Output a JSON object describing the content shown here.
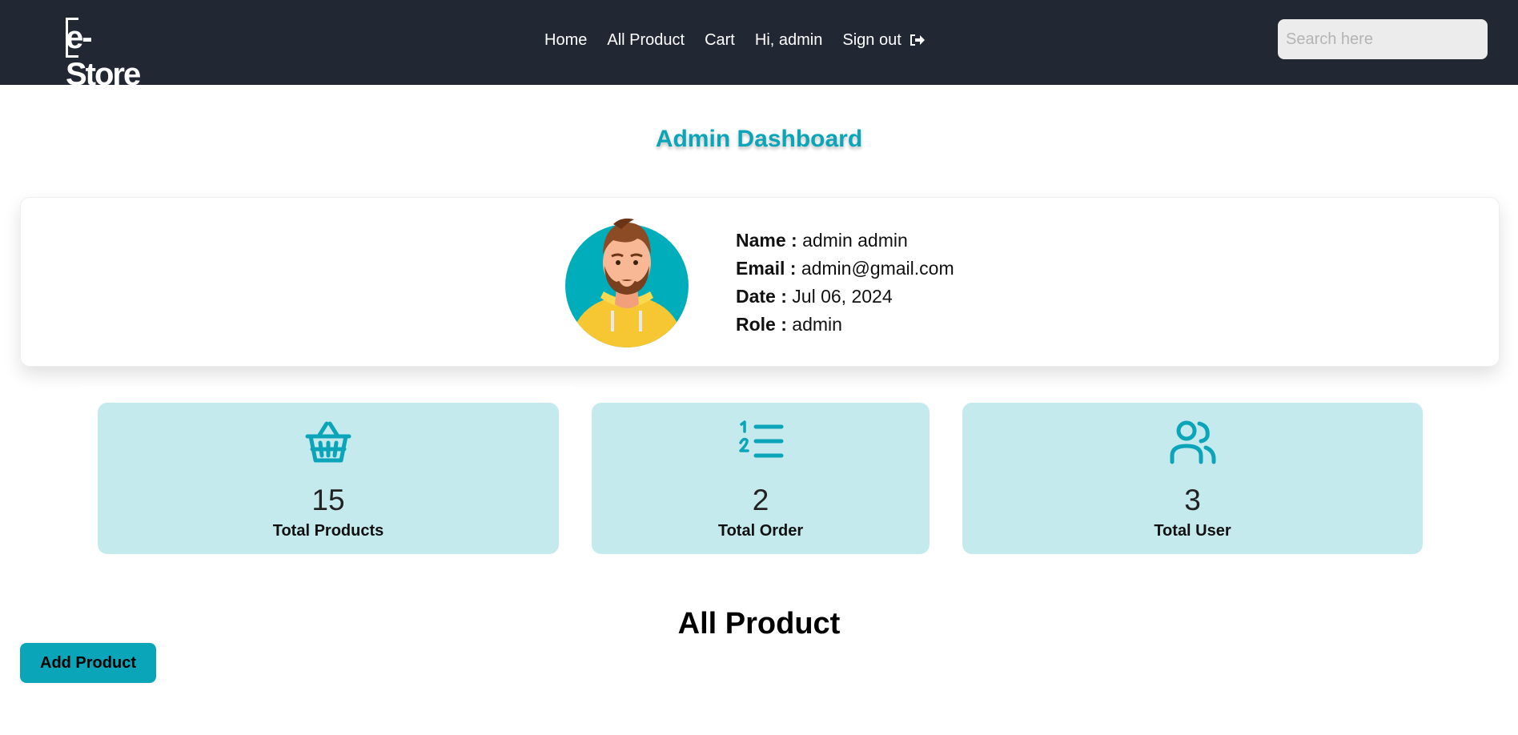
{
  "navbar": {
    "logo_text": "e-Store",
    "links": {
      "home": "Home",
      "all_product": "All Product",
      "cart": "Cart",
      "greeting": "Hi, admin",
      "sign_out": "Sign out"
    },
    "search_placeholder": "Search here"
  },
  "page": {
    "title": "Admin Dashboard"
  },
  "profile": {
    "name_label": "Name :",
    "name_value": "admin admin",
    "email_label": "Email :",
    "email_value": "admin@gmail.com",
    "date_label": "Date :",
    "date_value": "Jul 06, 2024",
    "role_label": "Role :",
    "role_value": "admin"
  },
  "stats": [
    {
      "icon": "basket-icon",
      "value": "15",
      "label": "Total Products"
    },
    {
      "icon": "list-icon",
      "value": "2",
      "label": "Total Order"
    },
    {
      "icon": "users-icon",
      "value": "3",
      "label": "Total User"
    }
  ],
  "products_section": {
    "title": "All Product",
    "add_button": "Add Product"
  },
  "colors": {
    "navbar_bg": "#212733",
    "accent": "#0aa5b8",
    "stat_card_bg": "#c4eaee"
  }
}
